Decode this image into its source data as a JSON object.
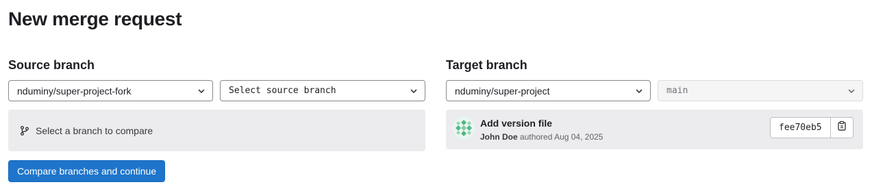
{
  "page": {
    "title": "New merge request"
  },
  "source": {
    "heading": "Source branch",
    "project_select": "nduminy/super-project-fork",
    "branch_select": "Select source branch",
    "empty_message": "Select a branch to compare"
  },
  "target": {
    "heading": "Target branch",
    "project_select": "nduminy/super-project",
    "branch_select": "main",
    "commit": {
      "title": "Add version file",
      "author": "John Doe",
      "authored_text": "authored",
      "date": "Aug 04, 2025",
      "sha": "fee70eb5"
    }
  },
  "actions": {
    "compare_button": "Compare branches and continue"
  },
  "colors": {
    "primary": "#1f75cb",
    "panel_bg": "#ececef",
    "avatar_green": "#52b788"
  },
  "icons": [
    "chevron-down-icon",
    "branch-icon",
    "copy-icon"
  ]
}
